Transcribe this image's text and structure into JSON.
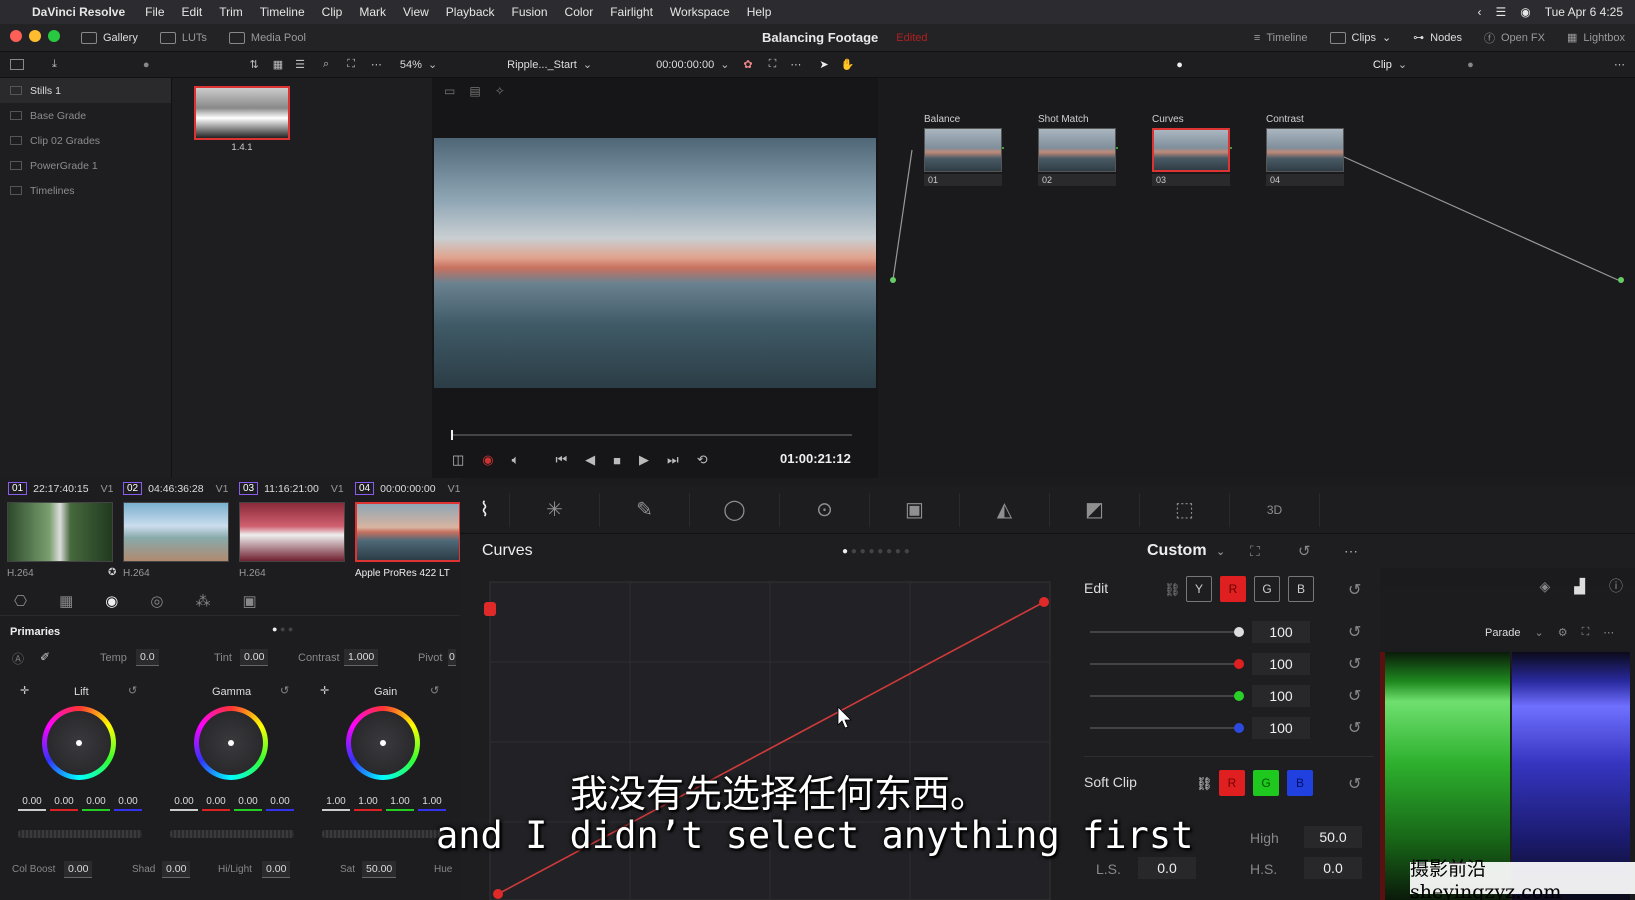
{
  "menubar": {
    "app": "DaVinci Resolve",
    "items": [
      "File",
      "Edit",
      "Trim",
      "Timeline",
      "Clip",
      "Mark",
      "View",
      "Playback",
      "Fusion",
      "Color",
      "Fairlight",
      "Workspace",
      "Help"
    ],
    "datetime": "Tue Apr 6  4:25"
  },
  "header": {
    "gallery": "Gallery",
    "luts": "LUTs",
    "media_pool": "Media Pool",
    "project": "Balancing Footage",
    "status": "Edited",
    "timeline": "Timeline",
    "clips": "Clips",
    "nodes": "Nodes",
    "openfx": "Open FX",
    "lightbox": "Lightbox"
  },
  "toolbar": {
    "zoom": "54%",
    "clip_name": "Ripple..._Start",
    "timecode": "00:00:00:00",
    "mode": "Clip"
  },
  "stills": {
    "items": [
      "Stills 1",
      "Base Grade",
      "Clip 02 Grades",
      "PowerGrade 1",
      "Timelines"
    ],
    "thumb_label": "1.4.1"
  },
  "viewer": {
    "timecode": "01:00:21:12"
  },
  "nodes": [
    {
      "label": "Balance",
      "num": "01"
    },
    {
      "label": "Shot Match",
      "num": "02"
    },
    {
      "label": "Curves",
      "num": "03"
    },
    {
      "label": "Contrast",
      "num": "04"
    }
  ],
  "clips": [
    {
      "num": "01",
      "tc": "22:17:40:15",
      "track": "V1",
      "codec": "H.264"
    },
    {
      "num": "02",
      "tc": "04:46:36:28",
      "track": "V1",
      "codec": "H.264"
    },
    {
      "num": "03",
      "tc": "11:16:21:00",
      "track": "V1",
      "codec": "H.264"
    },
    {
      "num": "04",
      "tc": "00:00:00:00",
      "track": "V1",
      "codec": "Apple ProRes 422 LT"
    }
  ],
  "primaries": {
    "title": "Primaries",
    "temp_label": "Temp",
    "temp": "0.0",
    "tint_label": "Tint",
    "tint": "0.00",
    "contrast_label": "Contrast",
    "contrast": "1.000",
    "pivot_label": "Pivot",
    "pivot": "0",
    "lift": "Lift",
    "gamma": "Gamma",
    "gain": "Gain",
    "lift_vals": [
      "0.00",
      "0.00",
      "0.00",
      "0.00"
    ],
    "gamma_vals": [
      "0.00",
      "0.00",
      "0.00",
      "0.00"
    ],
    "gain_vals": [
      "1.00",
      "1.00",
      "1.00",
      "1.00"
    ],
    "colboost_label": "Col Boost",
    "colboost": "0.00",
    "shad_label": "Shad",
    "shad": "0.00",
    "hilight_label": "Hi/Light",
    "hilight": "0.00",
    "sat_label": "Sat",
    "sat": "50.00",
    "hue_label": "Hue"
  },
  "curves": {
    "title": "Curves",
    "preset": "Custom"
  },
  "edit": {
    "title": "Edit",
    "channels": [
      "Y",
      "R",
      "G",
      "B"
    ],
    "values": [
      "100",
      "100",
      "100",
      "100"
    ],
    "softclip": "Soft Clip",
    "sc_channels": [
      "R",
      "G",
      "B"
    ],
    "high_label": "High",
    "high": "50.0",
    "ls_label": "L.S.",
    "ls": "0.0",
    "hs_label": "H.S.",
    "hs": "0.0"
  },
  "scope": {
    "mode": "Parade"
  },
  "subtitle": {
    "zh": "我没有先选择任何东西。",
    "en": "and I didn’t select anything first"
  },
  "watermark": "摄影前沿 sheyingzyz.com"
}
